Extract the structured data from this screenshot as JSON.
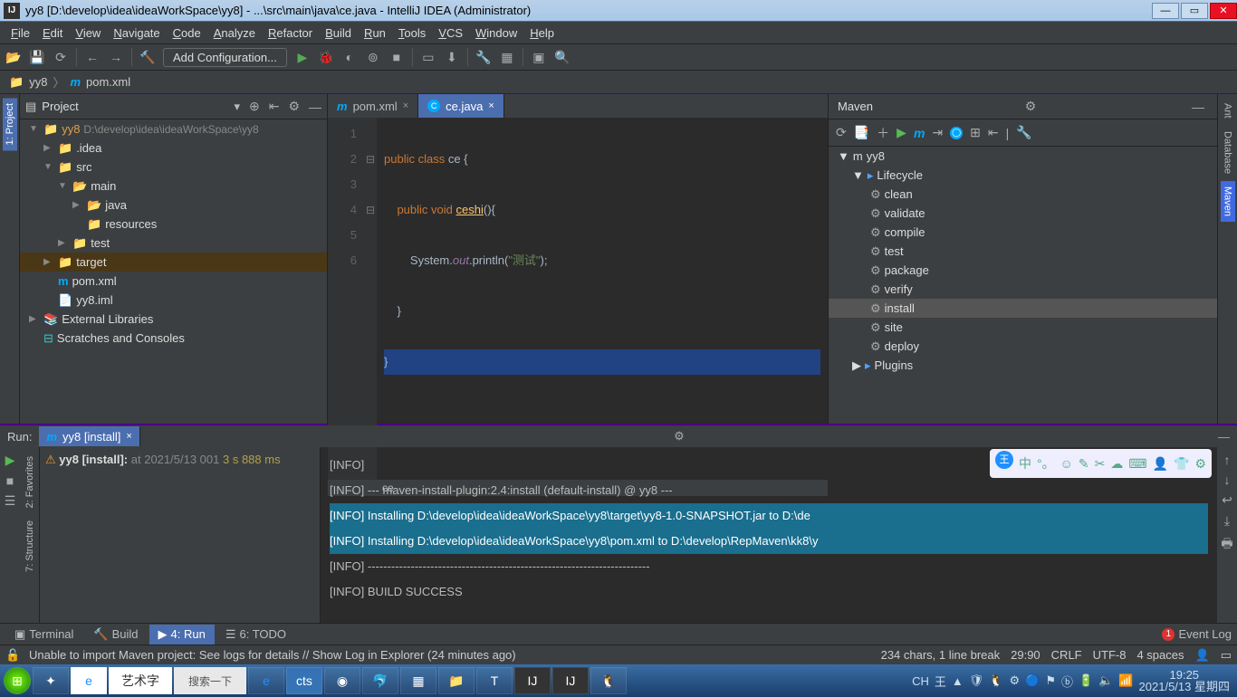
{
  "window": {
    "title": "yy8 [D:\\develop\\idea\\ideaWorkSpace\\yy8] - ...\\src\\main\\java\\ce.java - IntelliJ IDEA (Administrator)"
  },
  "menu": [
    "File",
    "Edit",
    "View",
    "Navigate",
    "Code",
    "Analyze",
    "Refactor",
    "Build",
    "Run",
    "Tools",
    "VCS",
    "Window",
    "Help"
  ],
  "toolbar": {
    "addconf": "Add Configuration..."
  },
  "breadcrumb": {
    "root": "yy8",
    "file": "pom.xml"
  },
  "sidetabs_left": [
    "1: Project"
  ],
  "sidetabs_left2": [
    "2: Favorites",
    "7: Structure"
  ],
  "sidetabs_right": [
    "Ant",
    "Database",
    "Maven"
  ],
  "project": {
    "title": "Project",
    "items": [
      {
        "depth": 0,
        "arr": "▼",
        "icon": "📁",
        "name": "yy8",
        "path": "D:\\develop\\idea\\ideaWorkSpace\\yy8",
        "root": true
      },
      {
        "depth": 1,
        "arr": "▶",
        "icon": "📁",
        "name": ".idea"
      },
      {
        "depth": 1,
        "arr": "▼",
        "icon": "📁",
        "name": "src"
      },
      {
        "depth": 2,
        "arr": "▼",
        "icon": "📂",
        "name": "main",
        "blue": true
      },
      {
        "depth": 3,
        "arr": "▶",
        "icon": "📂",
        "name": "java",
        "blue": true
      },
      {
        "depth": 3,
        "arr": "",
        "icon": "📁",
        "name": "resources"
      },
      {
        "depth": 2,
        "arr": "▶",
        "icon": "📁",
        "name": "test"
      },
      {
        "depth": 1,
        "arr": "▶",
        "icon": "📁",
        "name": "target",
        "red": true,
        "sel": true
      },
      {
        "depth": 1,
        "arr": "",
        "icon": "m",
        "name": "pom.xml",
        "m": true
      },
      {
        "depth": 1,
        "arr": "",
        "icon": "📄",
        "name": "yy8.iml"
      },
      {
        "depth": 0,
        "arr": "▶",
        "icon": "📚",
        "name": "External Libraries",
        "lib": true
      },
      {
        "depth": 0,
        "arr": "",
        "icon": "⊟",
        "name": "Scratches and Consoles",
        "scr": true
      }
    ]
  },
  "editor": {
    "tabs": [
      {
        "icon": "m",
        "label": "pom.xml",
        "active": false
      },
      {
        "icon": "c",
        "label": "ce.java",
        "active": true
      }
    ],
    "lines": [
      "1",
      "2",
      "3",
      "4",
      "5",
      "6"
    ],
    "crumb": "ce"
  },
  "code": {
    "l1_kw": "public class ",
    "l1_cls": "ce ",
    "l1_br": "{",
    "l2_kw": "public void ",
    "l2_fn": "ceshi",
    "l2_rest": "(){",
    "l3_pre": "System.",
    "l3_out": "out",
    "l3_mid": ".println(",
    "l3_str": "\"测试\"",
    "l3_end": ");",
    "l4": "}",
    "l5": "}"
  },
  "maven": {
    "title": "Maven",
    "root": "yy8",
    "lifecycle": "Lifecycle",
    "goals": [
      "clean",
      "validate",
      "compile",
      "test",
      "package",
      "verify",
      "install",
      "site",
      "deploy"
    ],
    "selected": "install",
    "plugins": "Plugins"
  },
  "run": {
    "title": "Run:",
    "tab": "yy8 [install]",
    "tree_label": "yy8 [install]:",
    "tree_time": "at 2021/5/13 001",
    "tree_dur": "3 s 888 ms",
    "lines": [
      {
        "t": "[INFO]",
        "hl": false
      },
      {
        "t": "[INFO] --- maven-install-plugin:2.4:install (default-install) @ yy8 ---",
        "hl": false
      },
      {
        "t": "[INFO] Installing D:\\develop\\idea\\ideaWorkSpace\\yy8\\target\\yy8-1.0-SNAPSHOT.jar to D:\\de",
        "hl": true
      },
      {
        "t": "[INFO] Installing D:\\develop\\idea\\ideaWorkSpace\\yy8\\pom.xml to D:\\develop\\RepMaven\\kk8\\y",
        "hl": true
      },
      {
        "t": "[INFO] ------------------------------------------------------------------------",
        "hl": false
      },
      {
        "t": "[INFO] BUILD SUCCESS",
        "hl": false
      }
    ]
  },
  "bottom_tabs": [
    {
      "icon": "▣",
      "label": "Terminal"
    },
    {
      "icon": "🔨",
      "label": "Build"
    },
    {
      "icon": "▶",
      "label": "4: Run",
      "active": true
    },
    {
      "icon": "☰",
      "label": "6: TODO"
    }
  ],
  "eventlog": {
    "badge": "1",
    "label": "Event Log"
  },
  "status": {
    "msg": "Unable to import Maven project: See logs for details // Show Log in Explorer (24 minutes ago)",
    "chars": "234 chars, 1 line break",
    "pos": "29:90",
    "eol": "CRLF",
    "enc": "UTF-8",
    "indent": "4 spaces"
  },
  "taskbar": {
    "search": "搜索一下",
    "browser_label": "艺术字",
    "ime": "CH",
    "time": "19:25",
    "date": "2021/5/13 星期四"
  }
}
